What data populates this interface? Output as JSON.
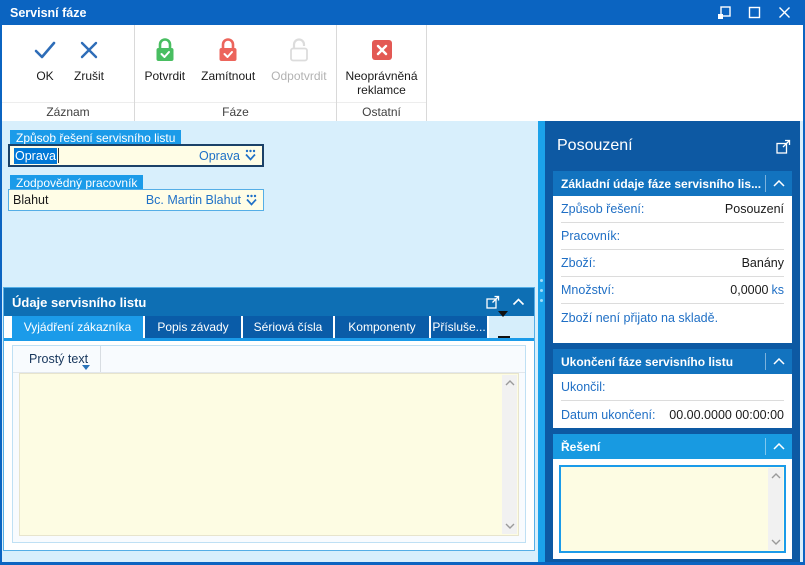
{
  "window": {
    "title": "Servisní fáze"
  },
  "toolbar": {
    "groups": [
      {
        "caption": "Záznam",
        "buttons": [
          {
            "label": "OK"
          },
          {
            "label": "Zrušit"
          }
        ]
      },
      {
        "caption": "Fáze",
        "buttons": [
          {
            "label": "Potvrdit"
          },
          {
            "label": "Zamítnout"
          },
          {
            "label": "Odpotvrdit",
            "disabled": true
          }
        ]
      },
      {
        "caption": "Ostatní",
        "buttons": [
          {
            "label": "Neoprávněná reklamce"
          }
        ]
      }
    ]
  },
  "fields": {
    "solution": {
      "label": "Způsob řešení servisního listu",
      "value": "Oprava",
      "display": "Oprava"
    },
    "worker": {
      "label": "Zodpovědný pracovník",
      "value": "Blahut",
      "display": "Bc. Martin Blahut"
    }
  },
  "details_panel": {
    "title": "Údaje servisního listu",
    "tabs": [
      {
        "label": "Vyjádření zákazníka",
        "active": true
      },
      {
        "label": "Popis závady"
      },
      {
        "label": "Sériová čísla"
      },
      {
        "label": "Komponenty"
      },
      {
        "label": "Přísluše..."
      }
    ],
    "subtab": {
      "label": "Prostý text"
    },
    "editor_value": ""
  },
  "sidebar": {
    "title": "Posouzení",
    "sections": [
      {
        "title": "Základní údaje fáze servisního lis...",
        "rows": [
          {
            "label": "Způsob řešení:",
            "value": "Posouzení"
          },
          {
            "label": "Pracovník:",
            "value": ""
          },
          {
            "label": "Zboží:",
            "value": "Banány"
          },
          {
            "label": "Množství:",
            "value": "0,0000",
            "unit": "ks"
          },
          {
            "label": "Zboží není přijato na skladě.",
            "value": ""
          }
        ]
      },
      {
        "title": "Ukončení fáze servisního listu",
        "rows": [
          {
            "label": "Ukončil:",
            "value": ""
          },
          {
            "label": "Datum ukončení:",
            "value": "00.00.0000 00:00:00"
          }
        ]
      },
      {
        "title": "Řešení",
        "editor_value": ""
      }
    ]
  },
  "icons": {
    "titlebar": [
      "popout-window-icon",
      "maximize-icon",
      "close-icon"
    ],
    "toolbar": [
      "check-icon",
      "x-icon",
      "lock-check-green-icon",
      "lock-check-red-icon",
      "lock-open-gray-icon",
      "red-square-x-icon"
    ],
    "misc": [
      "combo-dropdown-icon",
      "popout-icon",
      "chevron-up-icon",
      "more-tabs-icon",
      "scroll-up-icon",
      "scroll-down-icon"
    ]
  },
  "colors": {
    "titlebar": "#0b64c1",
    "accent": "#1b9be9",
    "panel_header": "#0e6fb4",
    "sidebar_bg": "#0d59a3",
    "section_header": "#1273bf",
    "solution_header": "#189ae1",
    "link_text": "#1f6fc5",
    "input_bg": "#fffde6",
    "editor_bg": "#fdfce3",
    "selection": "#0078d7",
    "confirm_green": "#49be61",
    "reject_red": "#ec655c"
  }
}
